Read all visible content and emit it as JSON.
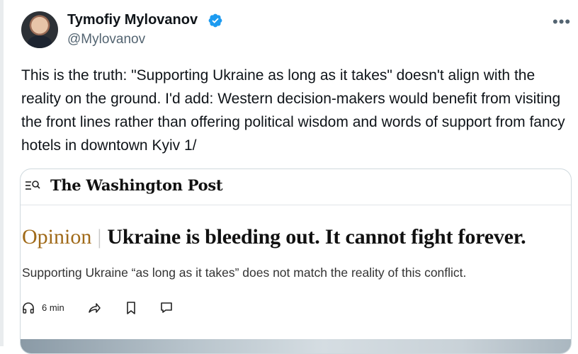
{
  "tweet": {
    "author": {
      "display_name": "Tymofiy Mylovanov",
      "handle": "@Mylovanov",
      "verified": true,
      "avatar_icon": "profile-photo"
    },
    "more_icon": "more-options-icon",
    "text": "This is the truth: \"Supporting Ukraine as long as it takes\" doesn't align with the reality on the ground. I'd add: Western decision-makers would benefit from visiting the front lines rather than offering political wisdom and words of support from fancy hotels in downtown Kyiv 1/"
  },
  "card": {
    "masthead": "The Washington Post",
    "section_label": "Opinion",
    "separator": "|",
    "headline": "Ukraine is bleeding out. It cannot fight forever.",
    "subheadline": "Supporting Ukraine “as long as it takes” does not match the reality of this conflict.",
    "read_time": "6 min",
    "icons": [
      "menu-search-icon",
      "headphones-icon",
      "share-icon",
      "bookmark-icon",
      "comment-icon"
    ]
  },
  "colors": {
    "verified_blue": "#1d9bf0",
    "opinion_gold": "#a06a19",
    "handle_gray": "#536471"
  }
}
